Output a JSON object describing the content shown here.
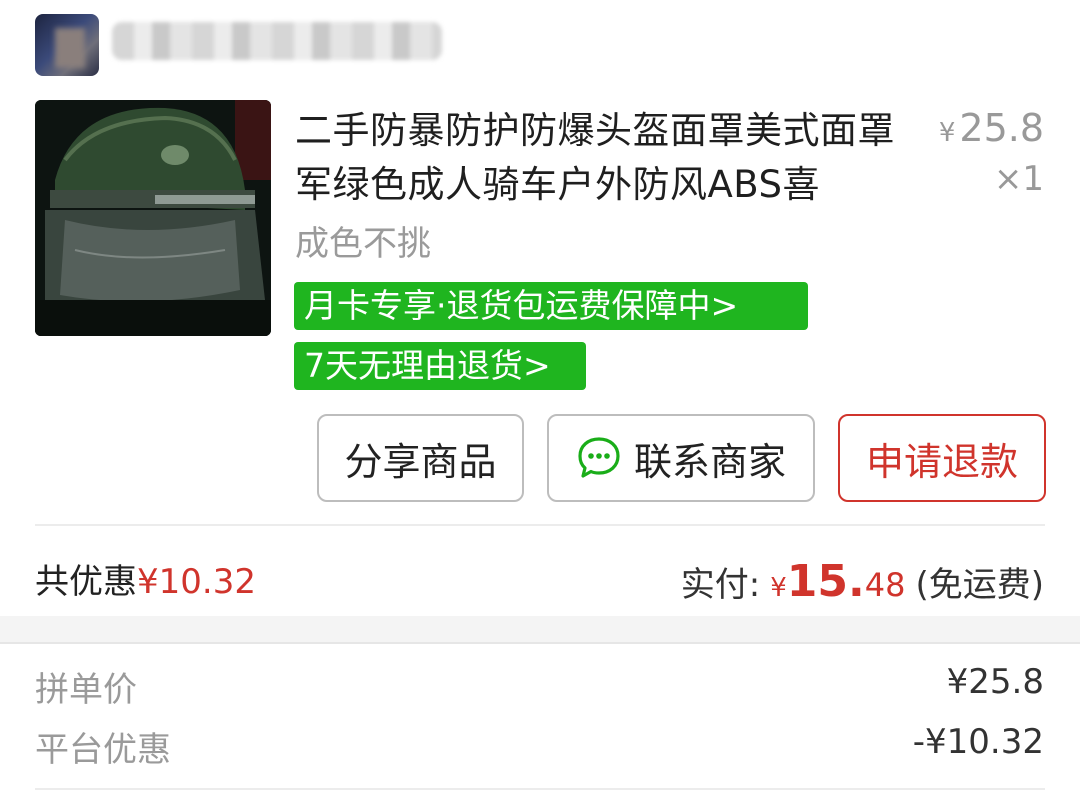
{
  "product": {
    "title": "二手防暴防护防爆头盔面罩美式面罩军绿色成人骑车户外防风ABS喜",
    "unit_price_symbol": "¥",
    "unit_price": "25.8",
    "quantity": "×1",
    "spec": "成色不挑",
    "tags": [
      "月卡专享·退货包运费保障中>",
      "7天无理由退货>"
    ]
  },
  "actions": {
    "share_label": "分享商品",
    "contact_label": "联系商家",
    "refund_label": "申请退款"
  },
  "summary": {
    "discount_label": "共优惠",
    "discount_value": "¥10.32",
    "paid_label": "实付:",
    "paid_symbol": "¥",
    "paid_int": "15.",
    "paid_dec": "48",
    "shipping_note": "(免运费)"
  },
  "details": [
    {
      "label": "拼单价",
      "value": "¥25.8"
    },
    {
      "label": "平台优惠",
      "value": "-¥10.32"
    }
  ],
  "colors": {
    "accent_red": "#d0342c",
    "tag_green": "#1fb51f",
    "wechat_green": "#1aad19"
  },
  "icons": {
    "chat": "chat-bubble-icon"
  }
}
